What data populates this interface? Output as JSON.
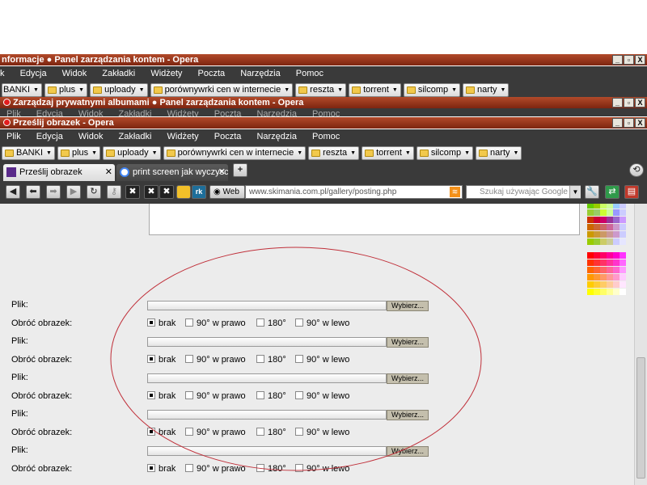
{
  "windows": [
    {
      "title": "nformacje ● Panel zarządzania kontem - Opera"
    },
    {
      "title": "Zarządzaj prywatnymi albumami ● Panel zarządzania kontem - Opera"
    },
    {
      "title": "Prześlij obrazek - Opera"
    }
  ],
  "window_buttons": {
    "minimize": "_",
    "restore": "▫",
    "close": "X"
  },
  "menus": {
    "back": [
      "k",
      "Edycja",
      "Widok",
      "Zakładki",
      "Widżety",
      "Poczta",
      "Narzędzia",
      "Pomoc"
    ],
    "front": [
      "Plik",
      "Edycja",
      "Widok",
      "Zakładki",
      "Widżety",
      "Poczta",
      "Narzędzia",
      "Pomoc"
    ],
    "middle_visible": [
      "Plik",
      "Edycja",
      "Widok",
      "Zakładki",
      "Widżety",
      "Poczta",
      "Narzędzia",
      "Pomoc"
    ]
  },
  "bookmarks": [
    "BANKI",
    "plus",
    "uploady",
    "porównywrki cen w internecie",
    "reszta",
    "torrent",
    "silcomp",
    "narty"
  ],
  "tabs": [
    {
      "label": "Prześlij obrazek",
      "close": "✕"
    },
    {
      "label": "print screen jak wyczyscić...",
      "close": "✕"
    }
  ],
  "new_tab": "+",
  "nav": {
    "web_label": "Web",
    "address": "www.skimania.com.pl/gallery/posting.php",
    "search_placeholder": "Szukaj używając Google",
    "rk_label": "rk"
  },
  "form": {
    "file_label": "Plik:",
    "rotate_label": "Obróć obrazek:",
    "browse_label": "Wybierz...",
    "options": [
      "brak",
      "90° w prawo",
      "180°",
      "90° w lewo"
    ],
    "selected_option": "brak"
  },
  "colors": {
    "titlebar": "#9a3a1e",
    "menubar": "#3a3a3a",
    "content_bg": "#ececec",
    "annotation_ellipse": "#c0303a"
  },
  "palette": [
    [
      "#66cc00",
      "#99cc00",
      "#ccff66",
      "#ccff99",
      "#99ccff",
      "#ccccff"
    ],
    [
      "#99cc33",
      "#99cc66",
      "#ccff33",
      "#ccff99",
      "#9999ff",
      "#ccccff"
    ],
    [
      "#cc3300",
      "#cc0033",
      "#cc0066",
      "#993399",
      "#9966cc",
      "#cc99ff"
    ],
    [
      "#cc6600",
      "#cc6633",
      "#cc6666",
      "#cc6699",
      "#cc99cc",
      "#ccccff"
    ],
    [
      "#cc9900",
      "#cc9933",
      "#cc9966",
      "#cc9999",
      "#cc99cc",
      "#ccccff"
    ],
    [
      "#99cc00",
      "#99cc33",
      "#cccc66",
      "#cccc99",
      "#ccccff",
      "#e6e6ff"
    ],
    [
      "#ff0000",
      "#ff0033",
      "#ff0066",
      "#ff0099",
      "#ff00cc",
      "#ff33ff"
    ],
    [
      "#ff3300",
      "#ff3333",
      "#ff3366",
      "#ff3399",
      "#ff33cc",
      "#ff66ff"
    ],
    [
      "#ff6600",
      "#ff6633",
      "#ff6666",
      "#ff6699",
      "#ff66cc",
      "#ff99ff"
    ],
    [
      "#ff9900",
      "#ff9933",
      "#ff9966",
      "#ff9999",
      "#ff99cc",
      "#ffccff"
    ],
    [
      "#ffcc00",
      "#ffcc33",
      "#ffcc66",
      "#ffcc99",
      "#ffcccc",
      "#ffe6ff"
    ],
    [
      "#ffff00",
      "#ffff33",
      "#ffff66",
      "#ffff99",
      "#ffffcc",
      "#ffffff"
    ]
  ]
}
